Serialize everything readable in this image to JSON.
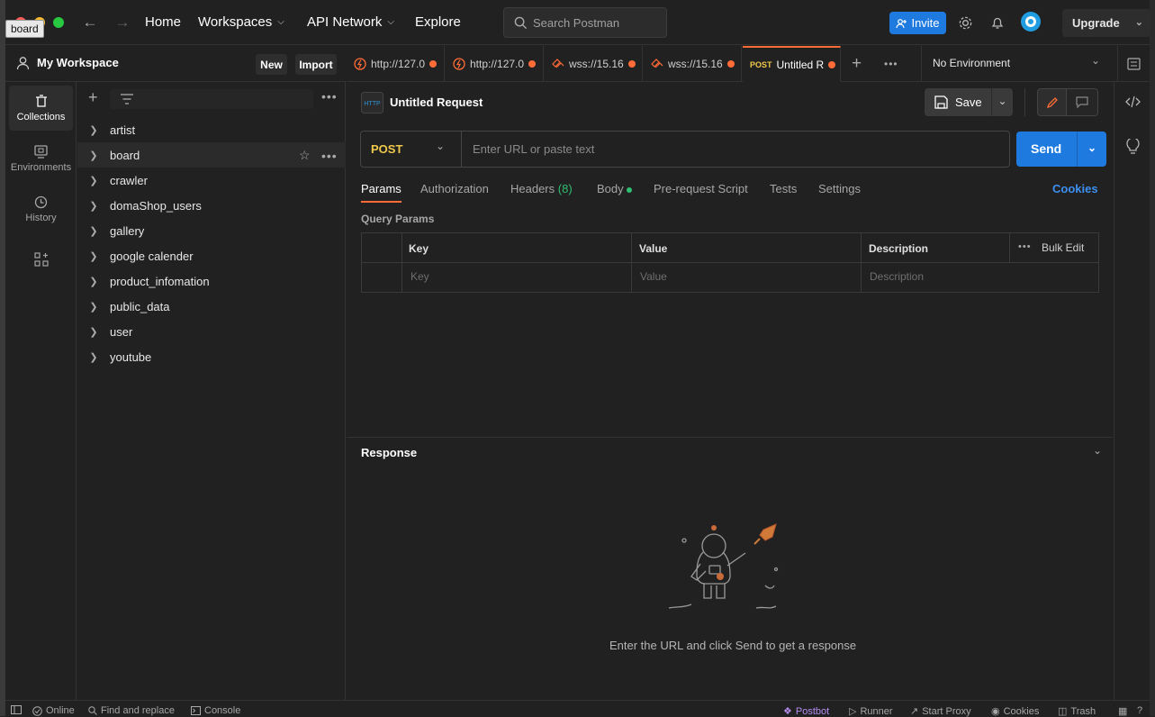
{
  "titlebar": {
    "tooltip": "board",
    "nav": {
      "home": "Home",
      "workspaces": "Workspaces",
      "api_network": "API Network",
      "explore": "Explore"
    },
    "search_placeholder": "Search Postman",
    "invite_label": "Invite",
    "upgrade_label": "Upgrade"
  },
  "workspace": {
    "title": "My Workspace",
    "new_label": "New",
    "import_label": "Import"
  },
  "rail": {
    "items": [
      {
        "label": "Collections",
        "icon": "trash-can-icon",
        "active": true
      },
      {
        "label": "Environments",
        "icon": "environment-icon",
        "active": false
      },
      {
        "label": "History",
        "icon": "history-icon",
        "active": false
      },
      {
        "label": "",
        "icon": "apps-grid-icon",
        "active": false
      }
    ]
  },
  "collections": [
    "artist",
    "board",
    "crawler",
    "domaShop_users",
    "gallery",
    "google calender",
    "product_infomation",
    "public_data",
    "user",
    "youtube"
  ],
  "tabs": [
    {
      "label": "http://127.0",
      "type": "http"
    },
    {
      "label": "http://127.0",
      "type": "http"
    },
    {
      "label": "wss://15.16",
      "type": "ws"
    },
    {
      "label": "wss://15.16",
      "type": "ws"
    },
    {
      "method": "POST",
      "label": "Untitled R",
      "type": "request",
      "active": true
    }
  ],
  "environment": "No Environment",
  "request": {
    "name": "Untitled Request",
    "save_label": "Save",
    "method": "POST",
    "url_placeholder": "Enter URL or paste text",
    "send_label": "Send",
    "tabs": {
      "params": "Params",
      "authorization": "Authorization",
      "headers": "Headers",
      "headers_count": "(8)",
      "body": "Body",
      "pre_request": "Pre-request Script",
      "tests": "Tests",
      "settings": "Settings"
    },
    "cookies_label": "Cookies",
    "query_params_title": "Query Params",
    "table": {
      "headers": {
        "key": "Key",
        "value": "Value",
        "description": "Description",
        "bulk_edit": "Bulk Edit"
      },
      "placeholders": {
        "key": "Key",
        "value": "Value",
        "description": "Description"
      }
    }
  },
  "response": {
    "title": "Response",
    "empty_message": "Enter the URL and click Send to get a response"
  },
  "statusbar": {
    "online": "Online",
    "find_replace": "Find and replace",
    "console": "Console",
    "postbot": "Postbot",
    "runner": "Runner",
    "start_proxy": "Start Proxy",
    "cookies": "Cookies",
    "trash": "Trash"
  },
  "colors": {
    "accent_orange": "#ff6c37",
    "accent_blue": "#1f7ae0",
    "method_post": "#f0c94c",
    "body_dot": "#2fbf71",
    "headers_count": "#2fbf71"
  }
}
